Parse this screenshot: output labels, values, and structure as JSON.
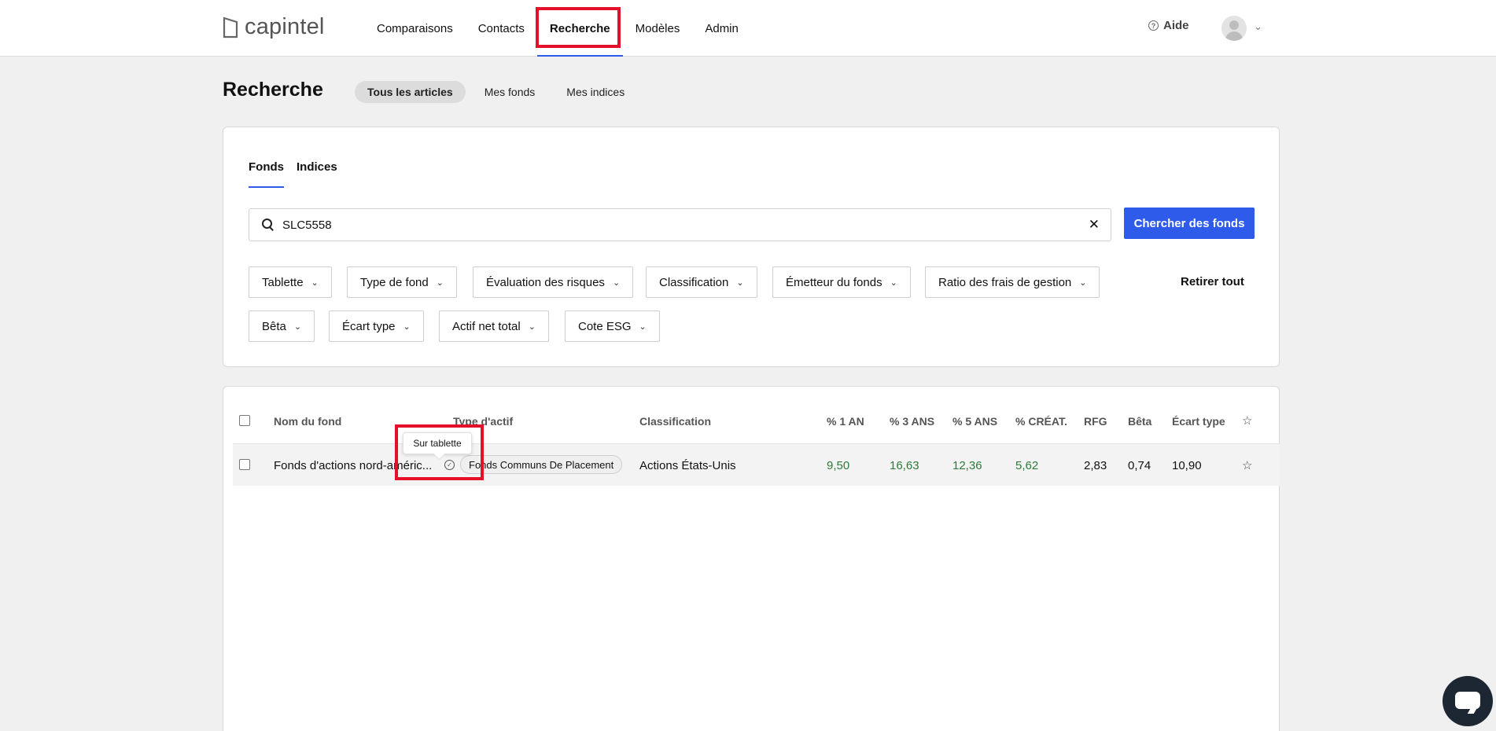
{
  "brand": {
    "name": "capintel"
  },
  "nav": {
    "items": [
      "Comparaisons",
      "Contacts",
      "Recherche",
      "Modèles",
      "Admin"
    ],
    "active": "Recherche"
  },
  "header": {
    "help_label": "Aide"
  },
  "page": {
    "title": "Recherche",
    "subtabs": [
      "Tous les articles",
      "Mes fonds",
      "Mes indices"
    ],
    "active_subtab": "Tous les articles"
  },
  "search": {
    "tabs": [
      "Fonds",
      "Indices"
    ],
    "active_tab": "Fonds",
    "query": "SLC5558",
    "submit_label": "Chercher des fonds",
    "filters": [
      "Tablette",
      "Type de fond",
      "Évaluation des risques",
      "Classification",
      "Émetteur du fonds",
      "Ratio des frais de gestion",
      "Bêta",
      "Écart type",
      "Actif net total",
      "Cote ESG"
    ],
    "clear_all_label": "Retirer tout"
  },
  "table": {
    "headers": [
      "Nom du fond",
      "Type d'actif",
      "Classification",
      "% 1 AN",
      "% 3 ANS",
      "% 5 ANS",
      "% CRÉAT.",
      "RFG",
      "Bêta",
      "Écart type"
    ],
    "rows": [
      {
        "name": "Fonds d'actions nord-améric...",
        "asset_type": "Fonds Communs De Placement",
        "classification": "Actions États-Unis",
        "y1": "9,50",
        "y3": "16,63",
        "y5": "12,36",
        "since_inception": "5,62",
        "mer": "2,83",
        "beta": "0,74",
        "std_dev": "10,90"
      }
    ]
  },
  "tooltip": {
    "text": "Sur tablette"
  },
  "colors": {
    "accent": "#2f5bea",
    "positive": "#2d7a3a",
    "highlight": "#e4102a"
  }
}
